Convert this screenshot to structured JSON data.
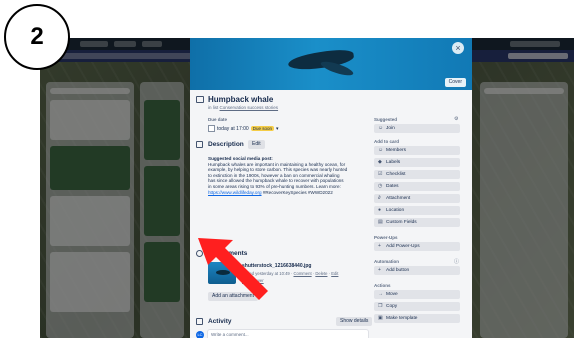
{
  "step_badge": "2",
  "modal": {
    "cover_button": "Cover",
    "close_glyph": "×",
    "title": "Humpback whale",
    "in_list_prefix": "in list",
    "in_list_name": "Conservation success stories",
    "due_label": "Due date",
    "due_value": "today at 17:00",
    "due_badge": "Due soon",
    "description_heading": "Description",
    "edit_label": "Edit",
    "description_title": "Suggested social media post:",
    "description_body": "Humpback whales are important in maintaining a healthy ocean, for example, by helping to store carbon. This species was nearly hunted to extinction in the 1900s, however a ban on commercial whaling has since allowed the humpback whale to recover with populations in some areas rising to 93% of pre-hunting numbers. Learn more:",
    "description_url": "https://www.wildlifeday.org",
    "description_tags": "#RecoverKeySpecies #WWD2022",
    "attachments_heading": "Attachments",
    "attachment_name": "shutterstock_1216638440.jpg",
    "attachment_added": "Added yesterday at 10:49",
    "attachment_comment": "Comment",
    "attachment_delete": "Delete",
    "attachment_edit": "Edit",
    "attachment_make_cover": "Make cover",
    "add_attachment": "Add an attachment",
    "activity_heading": "Activity",
    "show_details": "Show details",
    "avatar_initials": "LC",
    "comment_placeholder": "Write a comment..."
  },
  "sidebar": {
    "suggested_label": "Suggested",
    "join": "Join",
    "add_to_card_label": "Add to card",
    "add_to_card": [
      "Members",
      "Labels",
      "Checklist",
      "Dates",
      "Attachment",
      "Location",
      "Custom Fields"
    ],
    "power_ups_label": "Power-Ups",
    "add_power_ups": "Add Power-Ups",
    "automation_label": "Automation",
    "add_button": "Add button",
    "actions_label": "Actions",
    "actions": [
      "Move",
      "Copy",
      "Make template"
    ]
  },
  "colors": {
    "due_badge": "#f5cd47",
    "link": "#0c66e4",
    "arrow": "#ff1f1f"
  }
}
